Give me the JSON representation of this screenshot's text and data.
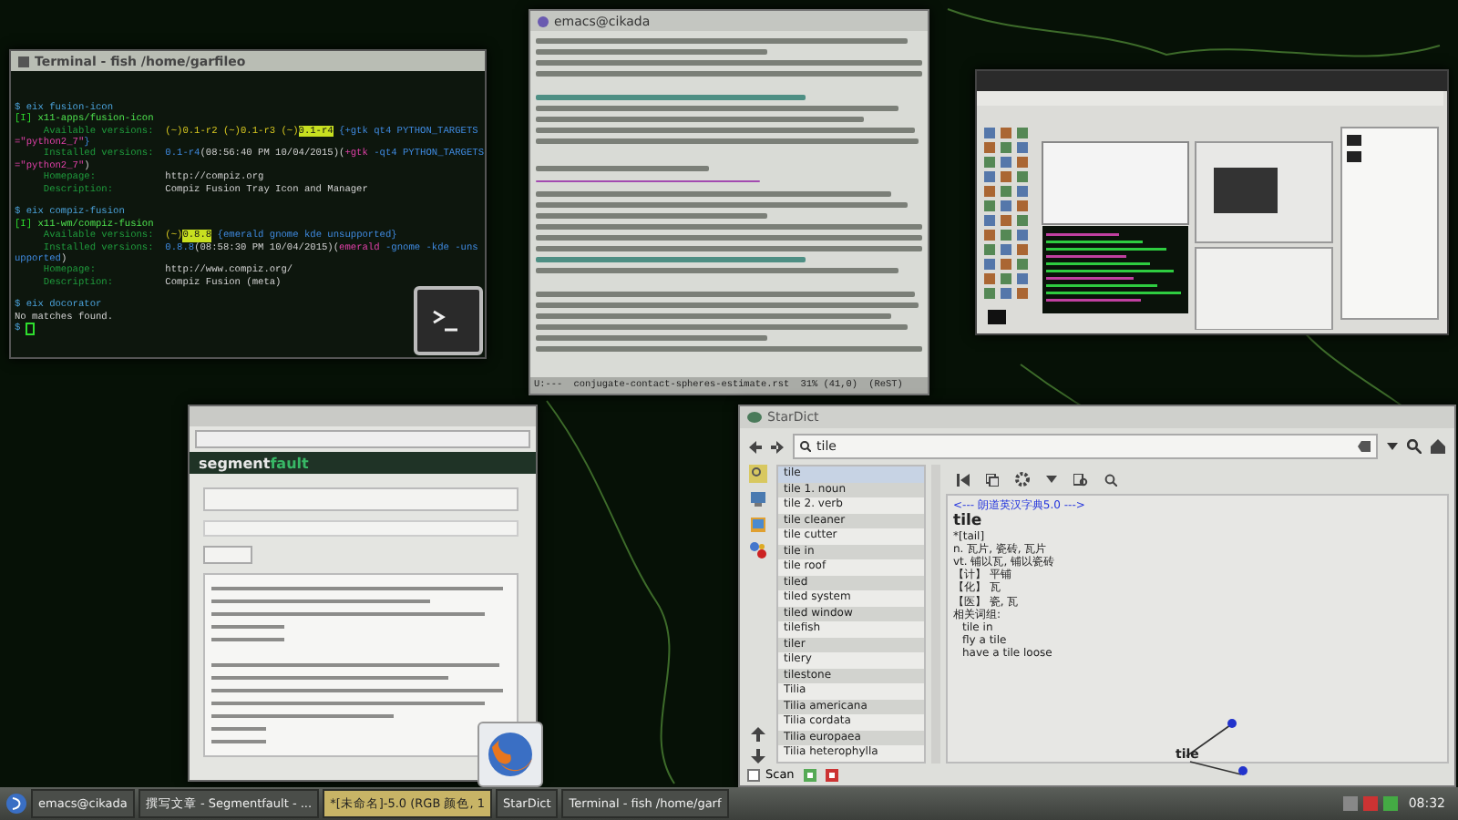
{
  "terminal": {
    "title": "Terminal - fish /home/garfileo",
    "lines": [
      {
        "kind": "text",
        "segments": [
          {
            "kind": "prompt",
            "text": "$ eix fusion-icon"
          }
        ]
      },
      {
        "kind": "text",
        "segments": [
          {
            "kind": "status",
            "text": "[I] "
          },
          {
            "kind": "pkg",
            "text": "x11-apps/fusion-icon"
          }
        ]
      },
      {
        "kind": "text",
        "segments": [
          {
            "kind": "label",
            "text": "     Available versions:  "
          },
          {
            "kind": "version",
            "text": "(~)0.1-r2 (~)0.1-r3 (~)"
          },
          {
            "kind": "hl",
            "text": "0.1-r4"
          },
          {
            "kind": "flag",
            "text": " {+gtk qt4 PYTHON_TARGETS"
          }
        ]
      },
      {
        "kind": "text",
        "segments": [
          {
            "kind": "neg",
            "text": "=\"python2_7\""
          },
          {
            "kind": "flag",
            "text": "}"
          }
        ]
      },
      {
        "kind": "text",
        "segments": [
          {
            "kind": "label",
            "text": "     Installed versions:  "
          },
          {
            "kind": "flag",
            "text": "0.1-r4"
          },
          {
            "kind": "plain",
            "text": "(08:56:40 PM 10/04/2015)("
          },
          {
            "kind": "neg",
            "text": "+gtk"
          },
          {
            "kind": "flag",
            "text": " -qt4 PYTHON_TARGETS"
          }
        ]
      },
      {
        "kind": "text",
        "segments": [
          {
            "kind": "neg",
            "text": "=\"python2_7\""
          },
          {
            "kind": "plain",
            "text": ")"
          }
        ]
      },
      {
        "kind": "text",
        "segments": [
          {
            "kind": "label",
            "text": "     Homepage:            "
          },
          {
            "kind": "plain",
            "text": "http://compiz.org"
          }
        ]
      },
      {
        "kind": "text",
        "segments": [
          {
            "kind": "label",
            "text": "     Description:         "
          },
          {
            "kind": "plain",
            "text": "Compiz Fusion Tray Icon and Manager"
          }
        ]
      },
      {
        "kind": "blank"
      },
      {
        "kind": "text",
        "segments": [
          {
            "kind": "prompt",
            "text": "$ eix compiz-fusion"
          }
        ]
      },
      {
        "kind": "text",
        "segments": [
          {
            "kind": "status",
            "text": "[I] "
          },
          {
            "kind": "pkg",
            "text": "x11-wm/compiz-fusion"
          }
        ]
      },
      {
        "kind": "text",
        "segments": [
          {
            "kind": "label",
            "text": "     Available versions:  "
          },
          {
            "kind": "version",
            "text": "(~)"
          },
          {
            "kind": "hl",
            "text": "0.8.8"
          },
          {
            "kind": "flag",
            "text": " {emerald gnome kde unsupported}"
          }
        ]
      },
      {
        "kind": "text",
        "segments": [
          {
            "kind": "label",
            "text": "     Installed versions:  "
          },
          {
            "kind": "flag",
            "text": "0.8.8"
          },
          {
            "kind": "plain",
            "text": "(08:58:30 PM 10/04/2015)("
          },
          {
            "kind": "neg",
            "text": "emerald"
          },
          {
            "kind": "flag",
            "text": " -gnome -kde -uns"
          }
        ]
      },
      {
        "kind": "text",
        "segments": [
          {
            "kind": "flag",
            "text": "upported"
          },
          {
            "kind": "plain",
            "text": ")"
          }
        ]
      },
      {
        "kind": "text",
        "segments": [
          {
            "kind": "label",
            "text": "     Homepage:            "
          },
          {
            "kind": "plain",
            "text": "http://www.compiz.org/"
          }
        ]
      },
      {
        "kind": "text",
        "segments": [
          {
            "kind": "label",
            "text": "     Description:         "
          },
          {
            "kind": "plain",
            "text": "Compiz Fusion (meta)"
          }
        ]
      },
      {
        "kind": "blank"
      },
      {
        "kind": "text",
        "segments": [
          {
            "kind": "prompt",
            "text": "$ eix docorator"
          }
        ]
      },
      {
        "kind": "text",
        "segments": [
          {
            "kind": "plain",
            "text": "No matches found."
          }
        ]
      },
      {
        "kind": "text",
        "segments": [
          {
            "kind": "prompt",
            "text": "$ "
          }
        ]
      }
    ]
  },
  "emacs": {
    "title": "emacs@cikada",
    "mode_line": "U:---  conjugate-contact-spheres-estimate.rst  31% (41,0)  (ReST)"
  },
  "browser": {
    "logo_left": "segment",
    "logo_right": "fault"
  },
  "stardict": {
    "title": "StarDict",
    "search": {
      "value": "tile"
    },
    "words": [
      {
        "text": "tile",
        "selected": true
      },
      {
        "text": "tile 1. noun",
        "selected": false
      },
      {
        "text": "tile 2. verb",
        "selected": false
      },
      {
        "text": "tile cleaner",
        "selected": false
      },
      {
        "text": "tile cutter",
        "selected": false
      },
      {
        "text": "tile in",
        "selected": false
      },
      {
        "text": "tile roof",
        "selected": false
      },
      {
        "text": "tiled",
        "selected": false
      },
      {
        "text": "tiled system",
        "selected": false
      },
      {
        "text": "tiled window",
        "selected": false
      },
      {
        "text": "tilefish",
        "selected": false
      },
      {
        "text": "tiler",
        "selected": false
      },
      {
        "text": "tilery",
        "selected": false
      },
      {
        "text": "tilestone",
        "selected": false
      },
      {
        "text": "Tilia",
        "selected": false
      },
      {
        "text": "Tilia americana",
        "selected": false
      },
      {
        "text": "Tilia cordata",
        "selected": false
      },
      {
        "text": "Tilia europaea",
        "selected": false
      },
      {
        "text": "Tilia heterophylla",
        "selected": false
      }
    ],
    "definition": {
      "dict_name": "<--- 朗道英汉字典5.0 --->",
      "headword": "tile",
      "phonetic": "*[tail]",
      "lines": [
        {
          "kind": "sense",
          "text": "n. 瓦片, 瓷砖, 瓦片"
        },
        {
          "kind": "sense",
          "text": "vt. 铺以瓦, 铺以瓷砖"
        },
        {
          "kind": "sense",
          "text": "【计】 平铺"
        },
        {
          "kind": "sense",
          "text": "【化】 瓦"
        },
        {
          "kind": "sense",
          "text": "【医】 瓷, 瓦"
        },
        {
          "kind": "sense",
          "text": "相关词组:"
        },
        {
          "kind": "phrase",
          "text": "tile in"
        },
        {
          "kind": "phrase",
          "text": "fly a tile"
        },
        {
          "kind": "phrase",
          "text": "have a tile loose"
        }
      ]
    },
    "graph_word": "tile",
    "scan": {
      "label": "Scan",
      "checked": false
    }
  },
  "taskbar": {
    "items": [
      {
        "label": "emacs@cikada",
        "selected": false
      },
      {
        "label": "撰写文章 - Segmentfault - ...",
        "selected": false
      },
      {
        "label": "*[未命名]-5.0 (RGB 颜色, 1",
        "selected": true
      },
      {
        "label": "StarDict",
        "selected": false
      },
      {
        "label": "Terminal - fish /home/garf",
        "selected": false
      }
    ],
    "clock": "08:32"
  }
}
